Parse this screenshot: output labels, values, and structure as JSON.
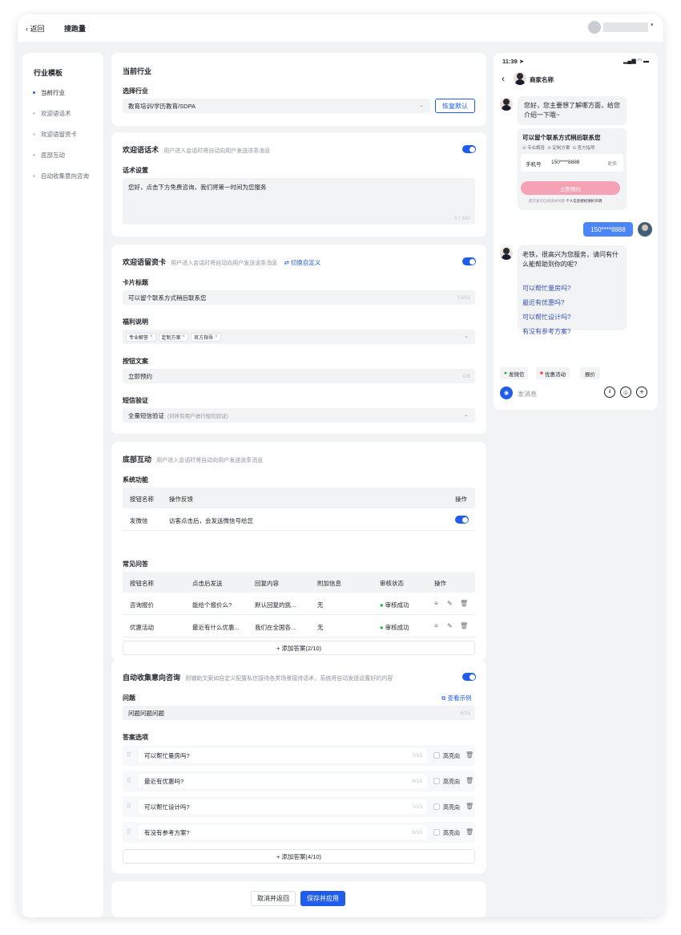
{
  "topbar": {
    "back_label": "返回",
    "title": "搜跑量"
  },
  "sidebar": {
    "title": "行业模板",
    "items": [
      {
        "label": "当前行业",
        "active": true
      },
      {
        "label": "欢迎语话术",
        "active": false
      },
      {
        "label": "欢迎语留资卡",
        "active": false
      },
      {
        "label": "底部互动",
        "active": false
      },
      {
        "label": "自动收集意向咨询",
        "active": false
      }
    ]
  },
  "industry": {
    "title": "当前行业",
    "select_label": "选择行业",
    "select_value": "教育培训/学历教育/SDPA",
    "restore_label": "恢复默认"
  },
  "welcome": {
    "title": "欢迎语话术",
    "desc": "用户进入会话时将自动向用户发送该条消息",
    "enabled": true,
    "field_label": "话术设置",
    "text": "您好，点击下方免费咨询，我们将第一时间为您服务",
    "count": "0 / 300"
  },
  "card": {
    "title": "欢迎语留资卡",
    "desc": "用户进入会话时将自动向用户发送该条消息",
    "switch_label": "切换自定义",
    "enabled": true,
    "card_title_label": "卡片标题",
    "card_title_value": "可以留个联系方式稍后联系您",
    "card_title_count": "13/15",
    "benefit_label": "福利说明",
    "benefits": [
      "专业解答",
      "定制方案",
      "官方指导"
    ],
    "button_label": "按钮文案",
    "button_value": "立即预约",
    "button_count": "0/6",
    "sms_label": "短信验证",
    "sms_value": "全量短信验证",
    "sms_hint": "(对所有用户进行短信验证)"
  },
  "bottom": {
    "title": "底部互动",
    "desc": "用户进入会话时将自动向用户发送该条消息",
    "sys_label": "系统功能",
    "sys_headers": [
      "按钮名称",
      "操作反馈",
      "操作"
    ],
    "sys_rows": [
      {
        "name": "发微信",
        "feedback": "访客点击后，会发送微信号给您"
      }
    ],
    "faq_label": "常见问答",
    "faq_headers": [
      "按钮名称",
      "点击后发送",
      "回复内容",
      "附加信息",
      "审核状态",
      "操作"
    ],
    "faq_rows": [
      {
        "name": "咨询报价",
        "send": "能给个报价么?",
        "reply": "默认回复的挑...",
        "extra": "无",
        "status": "审核成功"
      },
      {
        "name": "优惠活动",
        "send": "最近有什么优惠...",
        "reply": "我们在全国各...",
        "extra": "无",
        "status": "审核成功"
      }
    ],
    "add_label": "+ 添加答案(2/10)"
  },
  "intent": {
    "title": "自动收集意向咨询",
    "desc": "用辅助文案如自定义配置私信接待各类场景接待话术，系统将自动发送设置好的内容",
    "enabled": true,
    "q_label": "问题",
    "example_label": "查看示例",
    "q_value": "问题问题问题",
    "q_count": "6/15",
    "opt_label": "答案选项",
    "options": [
      {
        "text": "可以帮忙量房吗?",
        "count": "7/15",
        "hl": "高亮向"
      },
      {
        "text": "最近有优惠吗?",
        "count": "6/15",
        "hl": "高亮向"
      },
      {
        "text": "可以帮忙设计吗?",
        "count": "7/15",
        "hl": "高亮向"
      },
      {
        "text": "有没有参考方案?",
        "count": "8/15",
        "hl": "高亮向"
      }
    ],
    "add_label": "+ 添加答案(4/10)"
  },
  "footer": {
    "cancel_label": "取消并返回",
    "save_label": "保存并应用"
  },
  "phone": {
    "time": "11:39",
    "merchant": "商家名称",
    "greet": "您好，您主要想了解哪方面，给您介绍一下哦~",
    "card_title": "可以留个联系方式稍后联系您",
    "benefits": [
      "专业解答",
      "定制方案",
      "官方指导"
    ],
    "phone_label": "手机号",
    "phone_value": "150****8888",
    "change_label": "更换",
    "cta": "立即预约",
    "privacy": "提交表示已阅读并同意",
    "privacy_link": "个人信息授权保护声明",
    "user_msg": "150****8888",
    "reply": "老铁，很高兴为您服务，请问有什么能帮助到你的呢?",
    "questions": [
      "可以帮忙量房吗?",
      "最近有优惠吗?",
      "可以帮忙设计吗?",
      "有没有参考方案?"
    ],
    "quick": [
      "发微信",
      "优惠活动",
      "报价"
    ],
    "input_placeholder": "发消息"
  },
  "colors": {
    "primary": "#1f5dea",
    "pink": "#f6a2b5",
    "success": "#00b42a",
    "link": "#3451b2"
  }
}
